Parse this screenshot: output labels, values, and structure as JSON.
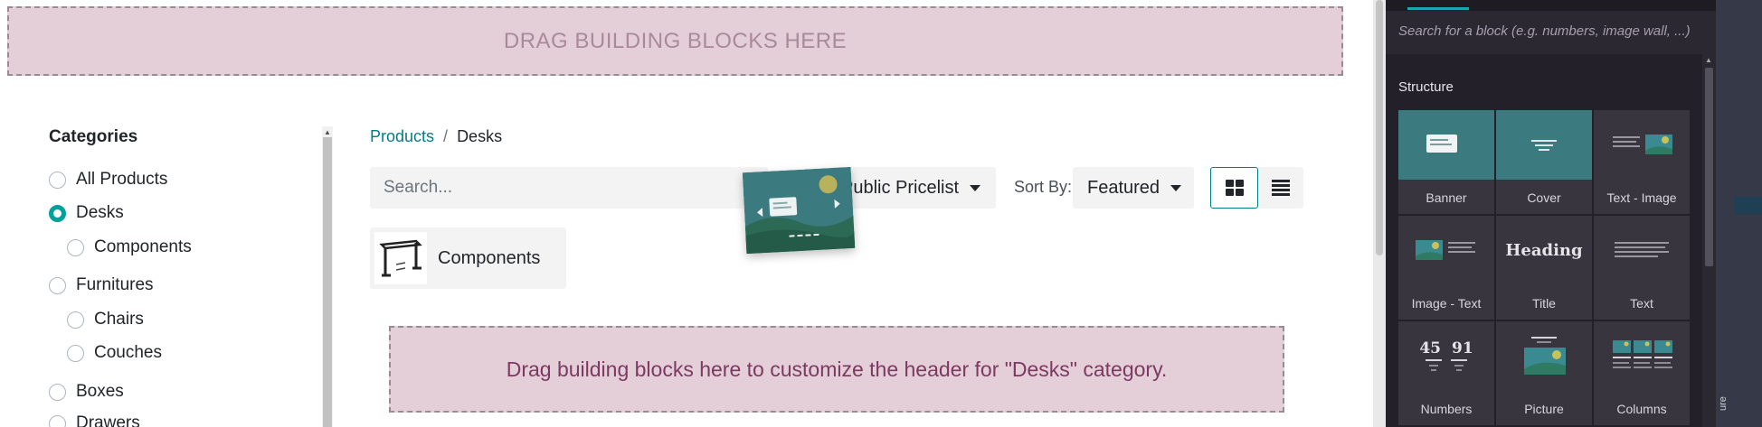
{
  "top_dropzone": {
    "text": "DRAG BUILDING BLOCKS HERE"
  },
  "categories": {
    "title": "Categories",
    "items": [
      {
        "label": "All Products",
        "checked": false,
        "level": 0
      },
      {
        "label": "Desks",
        "checked": true,
        "level": 0
      },
      {
        "label": "Components",
        "checked": false,
        "level": 1
      },
      {
        "label": "Furnitures",
        "checked": false,
        "level": 0
      },
      {
        "label": "Chairs",
        "checked": false,
        "level": 1
      },
      {
        "label": "Couches",
        "checked": false,
        "level": 1
      },
      {
        "label": "Boxes",
        "checked": false,
        "level": 0
      },
      {
        "label": "Drawers",
        "checked": false,
        "level": 0
      }
    ]
  },
  "breadcrumb": {
    "root": "Products",
    "separator": "/",
    "current": "Desks"
  },
  "toolbar": {
    "search_placeholder": "Search...",
    "pricelist": "Public Pricelist",
    "sort_label": "Sort By:",
    "sort_value": "Featured"
  },
  "subcategory": {
    "label": "Components"
  },
  "category_dropzone": {
    "text": "Drag building blocks here to customize the header for \"Desks\" category."
  },
  "panel": {
    "search_placeholder": "Search for a block (e.g. numbers, image wall, ...)",
    "section_title": "Structure",
    "blocks": [
      {
        "label": "Banner",
        "icon": "banner-preview-icon"
      },
      {
        "label": "Cover",
        "icon": "cover-preview-icon"
      },
      {
        "label": "Text - Image",
        "icon": "text-image-preview-icon"
      },
      {
        "label": "Image - Text",
        "icon": "image-text-preview-icon"
      },
      {
        "label": "Title",
        "icon": "title-preview-icon",
        "preview_text": "Heading"
      },
      {
        "label": "Text",
        "icon": "text-preview-icon"
      },
      {
        "label": "Numbers",
        "icon": "numbers-preview-icon",
        "preview_numbers": [
          "45",
          "91"
        ]
      },
      {
        "label": "Picture",
        "icon": "picture-preview-icon"
      },
      {
        "label": "Columns",
        "icon": "columns-preview-icon"
      }
    ]
  },
  "right_strip": {
    "vertical_text": "ure"
  },
  "colors": {
    "accent": "#017e84",
    "radio_checked": "#01a09d",
    "dropzone_bg": "#e4cfd8",
    "panel_bg": "#23202a",
    "block_teal": "#3b7b80"
  }
}
